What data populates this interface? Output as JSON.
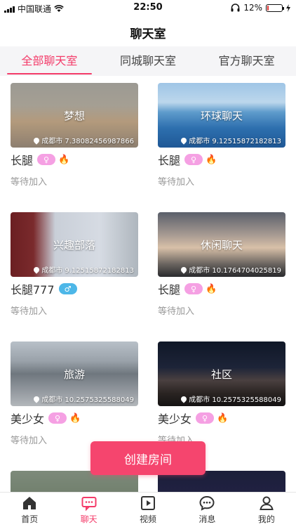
{
  "status": {
    "carrier": "中国联通",
    "time": "22:50",
    "battery_text": "12%",
    "battery_level": 0.12
  },
  "nav": {
    "title": "聊天室"
  },
  "tabs": [
    {
      "label": "全部聊天室",
      "active": true
    },
    {
      "label": "同城聊天室",
      "active": false
    },
    {
      "label": "官方聊天室",
      "active": false
    }
  ],
  "rooms": [
    {
      "name": "梦想",
      "location": "成都市 7.38082456987866",
      "owner": "长腿",
      "gender": "female",
      "gender_symbol": "♀",
      "hot": true,
      "status": "等待加入"
    },
    {
      "name": "环球聊天",
      "location": "成都市 9.12515872182813",
      "owner": "长腿",
      "gender": "female",
      "gender_symbol": "♀",
      "hot": true,
      "status": "等待加入"
    },
    {
      "name": "兴趣部落",
      "location": "成都市 9.12515872182813",
      "owner": "长腿777",
      "gender": "male",
      "gender_symbol": "♂",
      "hot": false,
      "status": "等待加入"
    },
    {
      "name": "休闲聊天",
      "location": "成都市 10.1764704025819",
      "owner": "长腿",
      "gender": "female",
      "gender_symbol": "♀",
      "hot": true,
      "status": "等待加入"
    },
    {
      "name": "旅游",
      "location": "成都市 10.2575325588049",
      "owner": "美少女",
      "gender": "female",
      "gender_symbol": "♀",
      "hot": true,
      "status": "等待加入"
    },
    {
      "name": "社区",
      "location": "成都市 10.2575325588049",
      "owner": "美少女",
      "gender": "female",
      "gender_symbol": "♀",
      "hot": true,
      "status": "等待加入"
    },
    {
      "name": "",
      "location": "",
      "owner": "",
      "gender": "",
      "gender_symbol": "",
      "hot": false,
      "status": ""
    },
    {
      "name": "",
      "location": "",
      "owner": "",
      "gender": "",
      "gender_symbol": "",
      "hot": false,
      "status": ""
    }
  ],
  "create_button": "创建房间",
  "tabbar": [
    {
      "label": "首页",
      "icon": "home-icon",
      "active": false
    },
    {
      "label": "聊天",
      "icon": "chat-icon",
      "active": true
    },
    {
      "label": "视频",
      "icon": "video-icon",
      "active": false
    },
    {
      "label": "消息",
      "icon": "message-icon",
      "active": false
    },
    {
      "label": "我的",
      "icon": "profile-icon",
      "active": false
    }
  ],
  "colors": {
    "accent": "#f43b69",
    "button": "#f5456e"
  }
}
